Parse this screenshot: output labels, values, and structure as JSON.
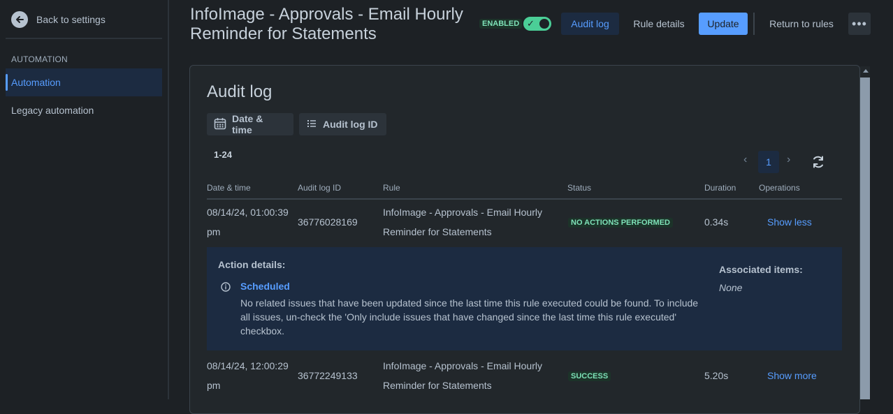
{
  "sidebar": {
    "back_label": "Back to settings",
    "section_label": "AUTOMATION",
    "items": [
      {
        "label": "Automation",
        "active": true
      },
      {
        "label": "Legacy automation",
        "active": false
      }
    ]
  },
  "header": {
    "title": "InfoImage - Approvals - Email Hourly Reminder for Statements",
    "status_badge": "ENABLED",
    "toggle_on": true,
    "buttons": {
      "audit_log": "Audit log",
      "rule_details": "Rule details",
      "update": "Update",
      "return_to_rules": "Return to rules",
      "more": "•••"
    }
  },
  "audit": {
    "heading": "Audit log",
    "filters": {
      "date_time": "Date & time",
      "audit_log_id": "Audit log ID"
    },
    "range": "1-24",
    "pagination": {
      "prev": "‹",
      "current": "1",
      "next": "›"
    },
    "columns": [
      "Date & time",
      "Audit log ID",
      "Rule",
      "Status",
      "Duration",
      "Operations"
    ],
    "rows": [
      {
        "date_line1": "08/14/24, 01:00:39",
        "date_line2": "pm",
        "id": "36776028169",
        "rule_line1": "InfoImage - Approvals - Email Hourly",
        "rule_line2": "Reminder for Statements",
        "status": "NO ACTIONS PERFORMED",
        "duration": "0.34s",
        "operation": "Show less"
      },
      {
        "date_line1": "08/14/24, 12:00:29",
        "date_line2": "pm",
        "id": "36772249133",
        "rule_line1": "InfoImage - Approvals - Email Hourly",
        "rule_line2": "Reminder for Statements",
        "status": "SUCCESS",
        "duration": "5.20s",
        "operation": "Show more"
      }
    ],
    "details": {
      "title": "Action details:",
      "action_name": "Scheduled",
      "message": "No related issues that have been updated since the last time this rule executed could be found. To include all issues, un-check the 'Only include issues that have changed since the last time this rule executed' checkbox.",
      "associated_label": "Associated items:",
      "associated_value": "None"
    }
  },
  "colors": {
    "background": "#1d2125",
    "accent": "#579dff",
    "success_bg": "#1c3329",
    "success_text": "#7ee2b8",
    "details_bg": "#1c2b41"
  }
}
